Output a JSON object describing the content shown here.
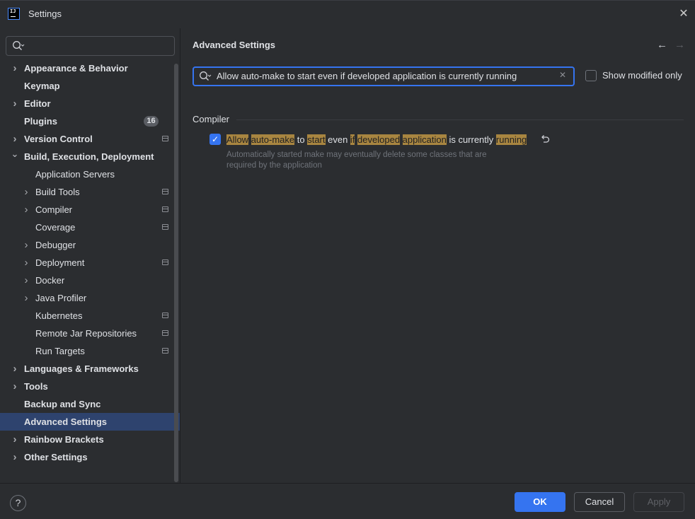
{
  "window": {
    "title": "Settings",
    "logo_text": "IJ"
  },
  "sidebar": {
    "search_placeholder": "",
    "items": [
      {
        "label": "Appearance & Behavior",
        "bold": true,
        "chevron": true,
        "level": 0
      },
      {
        "label": "Keymap",
        "bold": true,
        "chevron": false,
        "level": 0
      },
      {
        "label": "Editor",
        "bold": true,
        "chevron": true,
        "level": 0
      },
      {
        "label": "Plugins",
        "bold": true,
        "chevron": false,
        "level": 0,
        "badge": "16"
      },
      {
        "label": "Version Control",
        "bold": true,
        "chevron": true,
        "level": 0,
        "modified": true
      },
      {
        "label": "Build, Execution, Deployment",
        "bold": true,
        "chevron": true,
        "expanded": true,
        "level": 0
      },
      {
        "label": "Application Servers",
        "bold": false,
        "chevron": false,
        "level": 1
      },
      {
        "label": "Build Tools",
        "bold": false,
        "chevron": true,
        "level": 1,
        "modified": true
      },
      {
        "label": "Compiler",
        "bold": false,
        "chevron": true,
        "level": 1,
        "modified": true
      },
      {
        "label": "Coverage",
        "bold": false,
        "chevron": false,
        "level": 1,
        "modified": true
      },
      {
        "label": "Debugger",
        "bold": false,
        "chevron": true,
        "level": 1
      },
      {
        "label": "Deployment",
        "bold": false,
        "chevron": true,
        "level": 1,
        "modified": true
      },
      {
        "label": "Docker",
        "bold": false,
        "chevron": true,
        "level": 1
      },
      {
        "label": "Java Profiler",
        "bold": false,
        "chevron": true,
        "level": 1
      },
      {
        "label": "Kubernetes",
        "bold": false,
        "chevron": false,
        "level": 1,
        "modified": true
      },
      {
        "label": "Remote Jar Repositories",
        "bold": false,
        "chevron": false,
        "level": 1,
        "modified": true
      },
      {
        "label": "Run Targets",
        "bold": false,
        "chevron": false,
        "level": 1,
        "modified": true
      },
      {
        "label": "Languages & Frameworks",
        "bold": true,
        "chevron": true,
        "level": 0
      },
      {
        "label": "Tools",
        "bold": true,
        "chevron": true,
        "level": 0
      },
      {
        "label": "Backup and Sync",
        "bold": true,
        "chevron": false,
        "level": 0
      },
      {
        "label": "Advanced Settings",
        "bold": true,
        "chevron": false,
        "level": 0,
        "selected": true
      },
      {
        "label": "Rainbow Brackets",
        "bold": true,
        "chevron": true,
        "level": 0
      },
      {
        "label": "Other Settings",
        "bold": true,
        "chevron": true,
        "level": 0
      }
    ]
  },
  "main": {
    "title": "Advanced Settings",
    "search_value": "Allow auto-make to start even if developed application is currently running",
    "show_modified_label": "Show modified only",
    "group": "Compiler",
    "option": {
      "checked": true,
      "label_parts": [
        {
          "text": "Allow",
          "hl": true
        },
        {
          "text": " ",
          "hl": false
        },
        {
          "text": "auto-make",
          "hl": true
        },
        {
          "text": " to ",
          "hl": false
        },
        {
          "text": "start",
          "hl": true
        },
        {
          "text": " even ",
          "hl": false
        },
        {
          "text": "if",
          "hl": true
        },
        {
          "text": " ",
          "hl": false
        },
        {
          "text": "developed",
          "hl": true
        },
        {
          "text": " ",
          "hl": false
        },
        {
          "text": "application",
          "hl": true
        },
        {
          "text": " is currently ",
          "hl": false
        },
        {
          "text": "running",
          "hl": true
        }
      ],
      "description_line1": "Automatically started make may eventually delete some classes that are",
      "description_line2": "required by the application"
    }
  },
  "footer": {
    "help_label": "?",
    "ok_label": "OK",
    "cancel_label": "Cancel",
    "apply_label": "Apply"
  },
  "colors": {
    "accent": "#3574f0",
    "selection": "#2e436e",
    "highlight": "#a88540"
  }
}
